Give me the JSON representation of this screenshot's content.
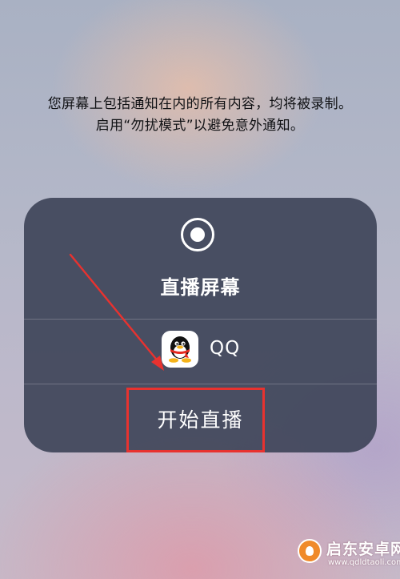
{
  "notice": {
    "line1": "您屏幕上包括通知在内的所有内容，均将被录制。",
    "line2": "启用“勿扰模式”以避免意外通知。"
  },
  "panel": {
    "icon": "screen-record-icon",
    "title": "直播屏幕",
    "app": {
      "icon": "qq-penguin-icon",
      "name": "QQ"
    },
    "start_button": "开始直播"
  },
  "annotation": {
    "color": "#e8322f"
  },
  "watermark": {
    "title": "启东安卓网",
    "url": "www.qdldtaoli.com"
  }
}
